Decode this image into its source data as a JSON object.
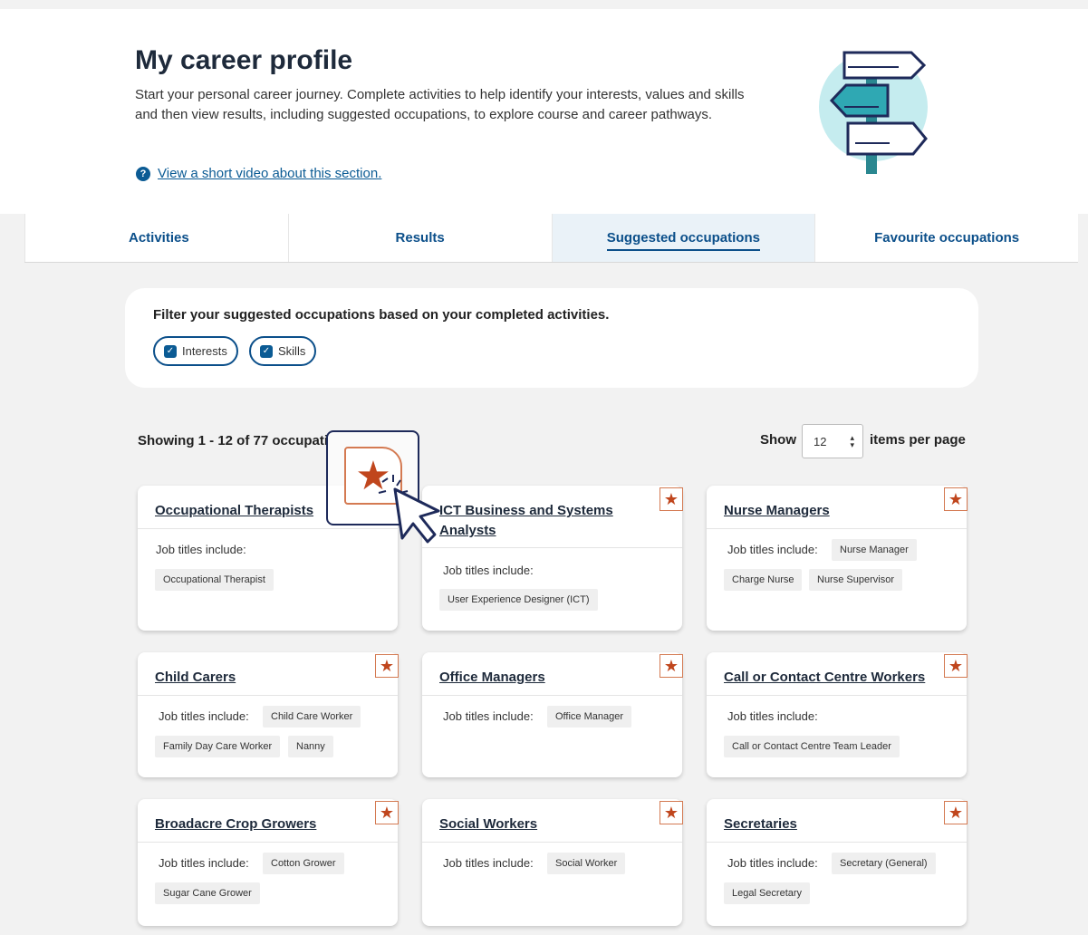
{
  "header": {
    "title": "My career profile",
    "description": "Start your personal career journey. Complete activities to help identify your interests, values and skills and then view results, including suggested occupations, to explore course and career pathways.",
    "video_link": "View a short video about this section.",
    "help_icon_glyph": "?"
  },
  "tabs": [
    {
      "label": "Activities"
    },
    {
      "label": "Results"
    },
    {
      "label": "Suggested occupations",
      "active": true
    },
    {
      "label": "Favourite occupations"
    }
  ],
  "filter": {
    "title": "Filter your suggested occupations based on your completed activities.",
    "chips": [
      {
        "label": "Interests",
        "checked": true
      },
      {
        "label": "Skills",
        "checked": true
      }
    ],
    "check_glyph": "✓"
  },
  "results": {
    "showing_text": "Showing 1 - 12 of 77 occupati",
    "show_label": "Show",
    "per_page_value": "12",
    "per_page_arrows": "▲▼",
    "items_label": "items per page"
  },
  "star_glyph": "★",
  "job_titles_label": "Job titles include:",
  "occupations": [
    {
      "title": "Occupational Therapists",
      "tags": [
        "Occupational Therapist"
      ]
    },
    {
      "title": "ICT Business and Systems Analysts",
      "tags": [
        "User Experience Designer (ICT)"
      ]
    },
    {
      "title": "Nurse Managers",
      "tags": [
        "Nurse Manager",
        "Charge Nurse",
        "Nurse Supervisor"
      ]
    },
    {
      "title": "Child Carers",
      "tags": [
        "Child Care Worker",
        "Family Day Care Worker",
        "Nanny"
      ]
    },
    {
      "title": "Office Managers",
      "tags": [
        "Office Manager"
      ]
    },
    {
      "title": "Call or Contact Centre Workers",
      "tags": [
        "Call or Contact Centre Team Leader"
      ]
    },
    {
      "title": "Broadacre Crop Growers",
      "tags": [
        "Cotton Grower",
        "Sugar Cane Grower"
      ]
    },
    {
      "title": "Social Workers",
      "tags": [
        "Social Worker"
      ]
    },
    {
      "title": "Secretaries",
      "tags": [
        "Secretary (General)",
        "Legal Secretary"
      ]
    }
  ],
  "colors": {
    "accent": "#0b4f8a",
    "star": "#c0461d",
    "teal": "#2fa8b3"
  }
}
